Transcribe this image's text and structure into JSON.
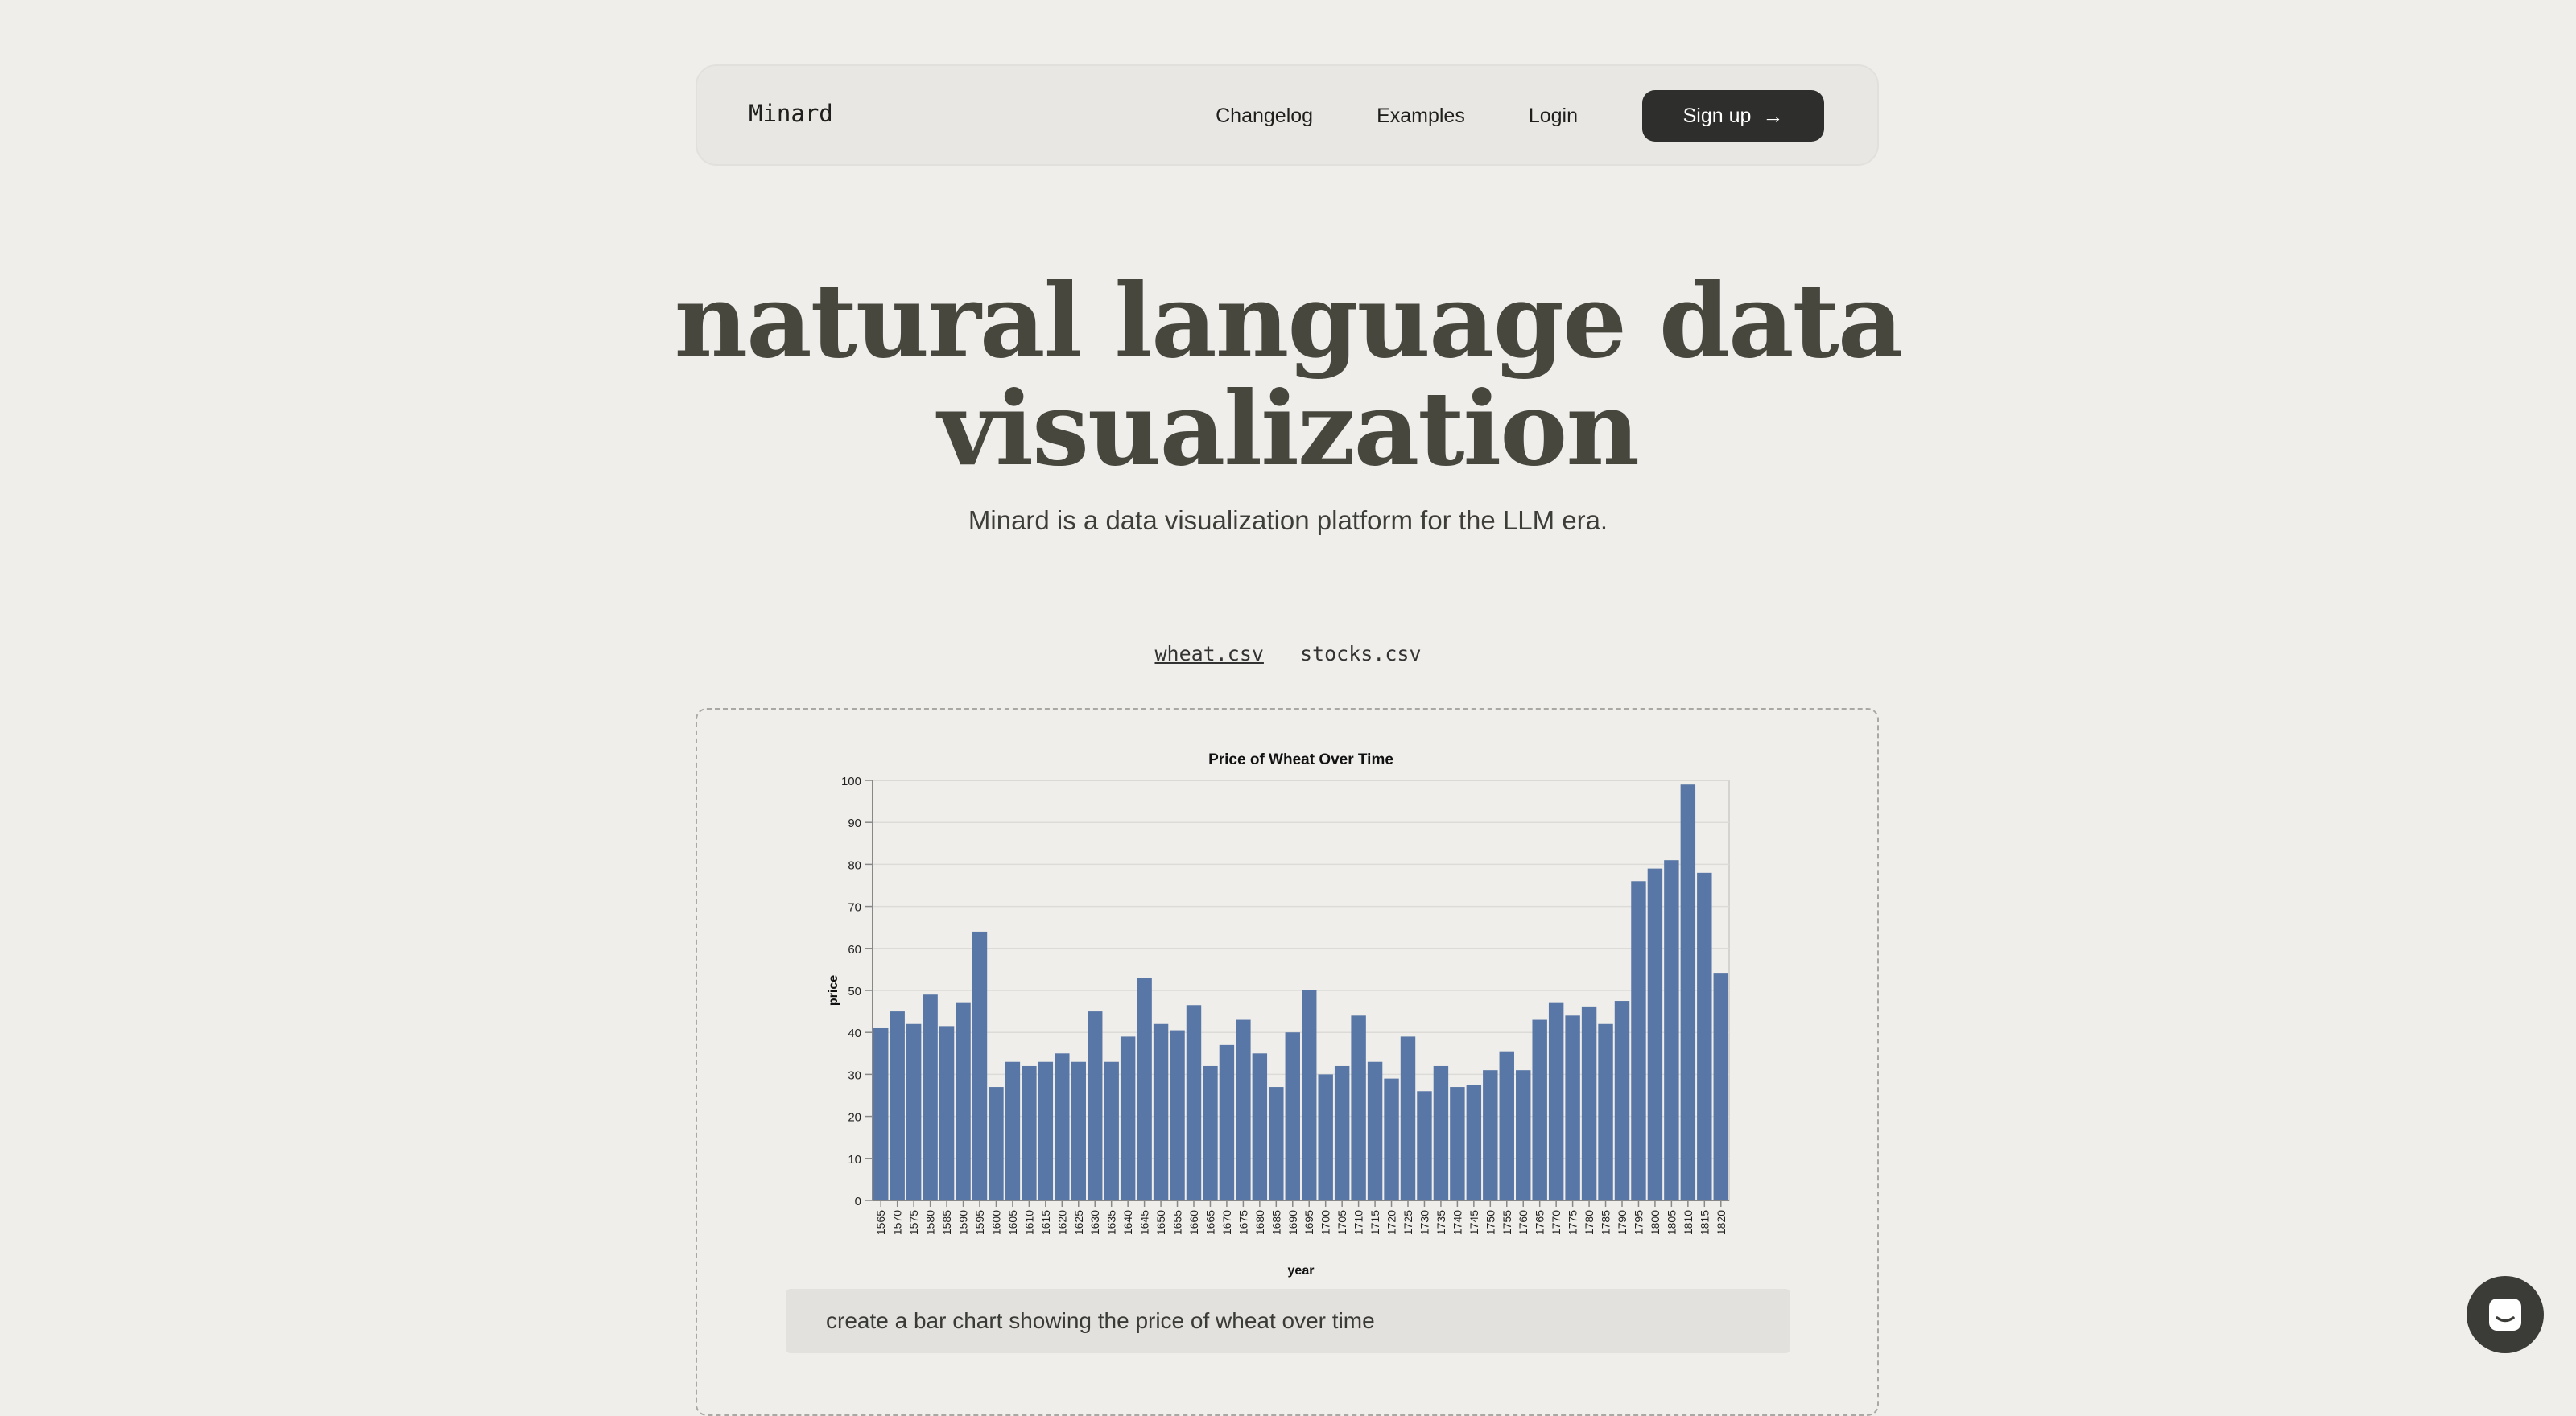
{
  "nav": {
    "logo": "Minard",
    "links": [
      "Changelog",
      "Examples",
      "Login"
    ],
    "signup": "Sign up"
  },
  "hero": {
    "title_line1": "natural language data",
    "title_line2": "visualization",
    "subtitle": "Minard is a data visualization platform for the LLM era."
  },
  "files": [
    "wheat.csv",
    "stocks.csv"
  ],
  "active_file": "wheat.csv",
  "prompt": "create a bar chart showing the price of wheat over time",
  "icons": {
    "arrow": "arrow-right-icon",
    "chat": "chat-icon"
  },
  "colors": {
    "bar": "#5876a6",
    "signup_bg": "#2e2e2c",
    "title": "#47473e"
  },
  "chart_data": {
    "type": "bar",
    "title": "Price of Wheat Over Time",
    "xlabel": "year",
    "ylabel": "price",
    "ylim": [
      0,
      100
    ],
    "yticks": [
      0,
      10,
      20,
      30,
      40,
      50,
      60,
      70,
      80,
      90,
      100
    ],
    "grid": true,
    "categories": [
      "1565",
      "1570",
      "1575",
      "1580",
      "1585",
      "1590",
      "1595",
      "1600",
      "1605",
      "1610",
      "1615",
      "1620",
      "1625",
      "1630",
      "1635",
      "1640",
      "1645",
      "1650",
      "1655",
      "1660",
      "1665",
      "1670",
      "1675",
      "1680",
      "1685",
      "1690",
      "1695",
      "1700",
      "1705",
      "1710",
      "1715",
      "1720",
      "1725",
      "1730",
      "1735",
      "1740",
      "1745",
      "1750",
      "1755",
      "1760",
      "1765",
      "1770",
      "1775",
      "1780",
      "1785",
      "1790",
      "1795",
      "1800",
      "1805",
      "1810",
      "1815",
      "1820"
    ],
    "values": [
      41,
      45,
      42,
      49,
      41.5,
      47,
      64,
      27,
      33,
      32,
      33,
      35,
      33,
      45,
      33,
      39,
      53,
      42,
      40.5,
      46.5,
      32,
      37,
      43,
      35,
      27,
      40,
      50,
      30,
      32,
      44,
      33,
      29,
      39,
      26,
      32,
      27,
      27.5,
      31,
      35.5,
      31,
      43,
      47,
      44,
      46,
      42,
      47.5,
      76,
      79,
      81,
      99,
      78,
      54
    ]
  }
}
